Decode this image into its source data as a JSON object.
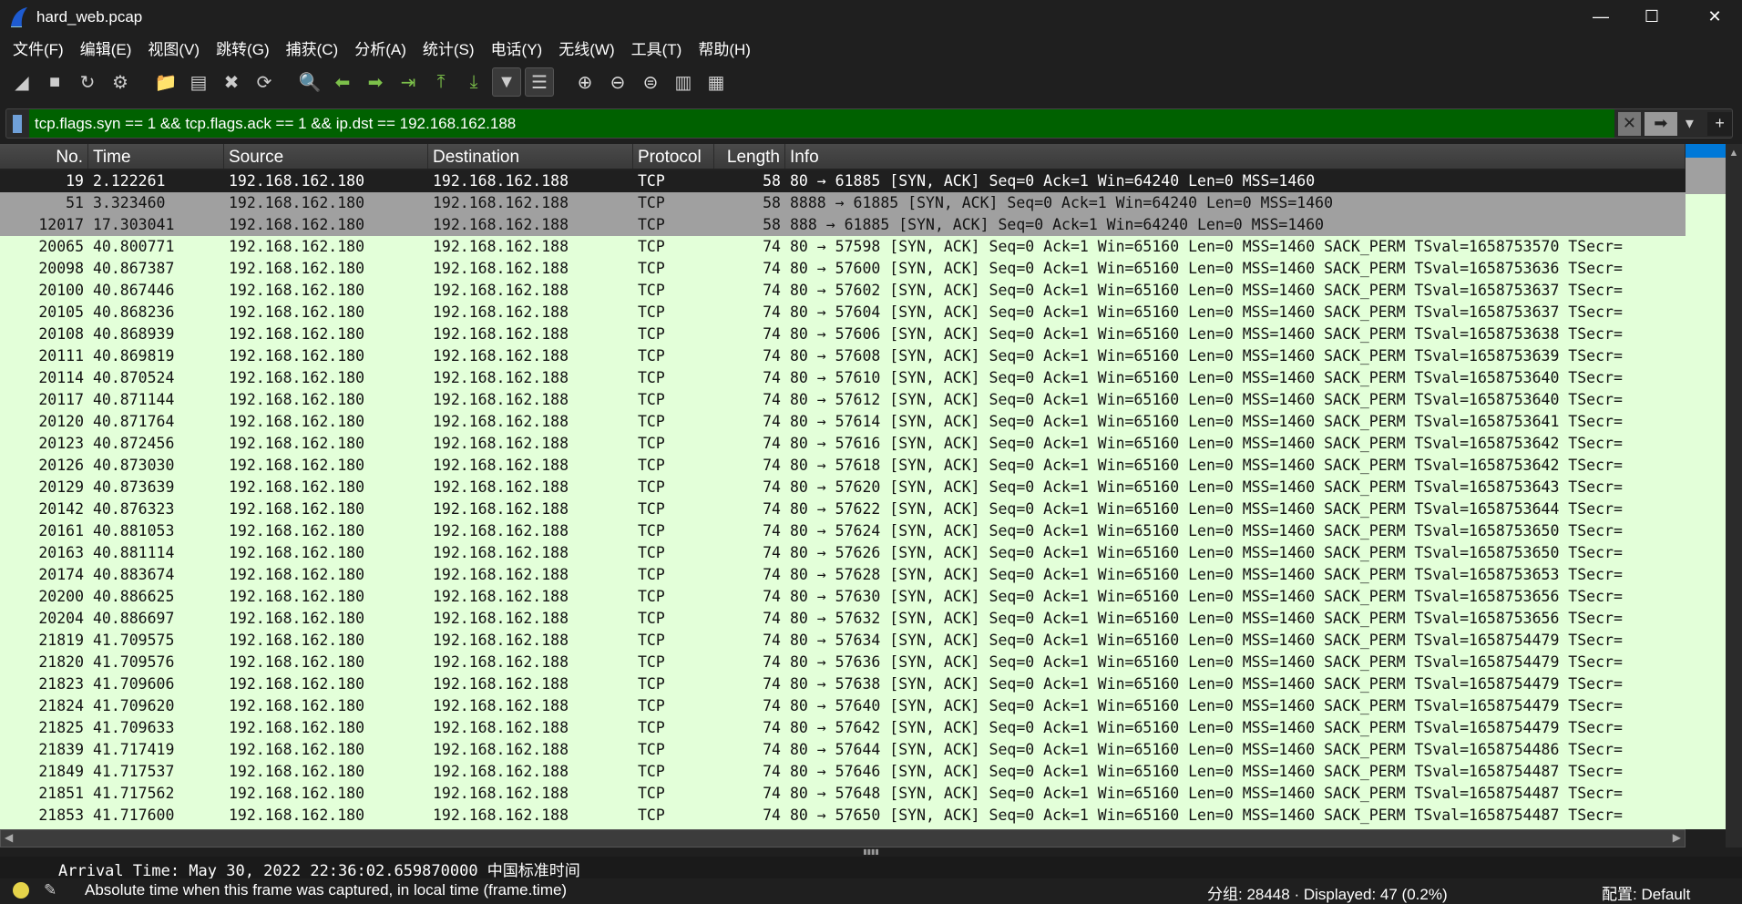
{
  "window": {
    "title": "hard_web.pcap",
    "minimize": "—",
    "maximize": "☐",
    "close": "✕"
  },
  "menu": [
    "文件(F)",
    "编辑(E)",
    "视图(V)",
    "跳转(G)",
    "捕获(C)",
    "分析(A)",
    "统计(S)",
    "电话(Y)",
    "无线(W)",
    "工具(T)",
    "帮助(H)"
  ],
  "toolbar": [
    {
      "icon": "start-capture-icon",
      "glyph": "◢"
    },
    {
      "icon": "stop-capture-icon",
      "glyph": "■"
    },
    {
      "icon": "restart-capture-icon",
      "glyph": "↻"
    },
    {
      "icon": "capture-options-icon",
      "glyph": "⚙"
    },
    "sep",
    {
      "icon": "open-file-icon",
      "glyph": "📁"
    },
    {
      "icon": "save-file-icon",
      "glyph": "▤"
    },
    {
      "icon": "close-file-icon",
      "glyph": "✖"
    },
    {
      "icon": "reload-file-icon",
      "glyph": "⟳"
    },
    "sep",
    {
      "icon": "find-packet-icon",
      "glyph": "🔍"
    },
    {
      "icon": "go-back-icon",
      "glyph": "⬅"
    },
    {
      "icon": "go-forward-icon",
      "glyph": "➡"
    },
    {
      "icon": "go-to-packet-icon",
      "glyph": "⇥"
    },
    {
      "icon": "go-first-icon",
      "glyph": "⤒"
    },
    {
      "icon": "go-last-icon",
      "glyph": "⤓"
    },
    {
      "icon": "auto-scroll-icon",
      "glyph": "▼",
      "active": true
    },
    {
      "icon": "colorize-icon",
      "glyph": "☰",
      "active": true
    },
    "sep",
    {
      "icon": "zoom-in-icon",
      "glyph": "⊕"
    },
    {
      "icon": "zoom-out-icon",
      "glyph": "⊖"
    },
    {
      "icon": "zoom-reset-icon",
      "glyph": "⊜"
    },
    {
      "icon": "resize-columns-icon",
      "glyph": "▥"
    },
    {
      "icon": "layout-icon",
      "glyph": "▦"
    }
  ],
  "filter": {
    "value": "tcp.flags.syn == 1 && tcp.flags.ack == 1 && ip.dst == 192.168.162.188",
    "clear": "✕",
    "apply": "➡",
    "dropdown": "▾",
    "add": "+"
  },
  "columns": [
    "No.",
    "Time",
    "Source",
    "Destination",
    "Protocol",
    "Length",
    "Info"
  ],
  "colors": {
    "selected": "#1f1f1f",
    "gray": "#a0a0a0",
    "normal": "#e3ffd9",
    "filter_ok": "#006100"
  },
  "packets": [
    {
      "no": "19",
      "time": "2.122261",
      "src": "192.168.162.180",
      "dst": "192.168.162.188",
      "proto": "TCP",
      "len": "58",
      "info": "80 → 61885 [SYN, ACK] Seq=0 Ack=1 Win=64240 Len=0 MSS=1460",
      "style": "sel"
    },
    {
      "no": "51",
      "time": "3.323460",
      "src": "192.168.162.180",
      "dst": "192.168.162.188",
      "proto": "TCP",
      "len": "58",
      "info": "8888 → 61885 [SYN, ACK] Seq=0 Ack=1 Win=64240 Len=0 MSS=1460",
      "style": "gray"
    },
    {
      "no": "12017",
      "time": "17.303041",
      "src": "192.168.162.180",
      "dst": "192.168.162.188",
      "proto": "TCP",
      "len": "58",
      "info": "888 → 61885 [SYN, ACK] Seq=0 Ack=1 Win=64240 Len=0 MSS=1460",
      "style": "gray"
    },
    {
      "no": "20065",
      "time": "40.800771",
      "src": "192.168.162.180",
      "dst": "192.168.162.188",
      "proto": "TCP",
      "len": "74",
      "info": "80 → 57598 [SYN, ACK] Seq=0 Ack=1 Win=65160 Len=0 MSS=1460 SACK_PERM TSval=1658753570 TSecr="
    },
    {
      "no": "20098",
      "time": "40.867387",
      "src": "192.168.162.180",
      "dst": "192.168.162.188",
      "proto": "TCP",
      "len": "74",
      "info": "80 → 57600 [SYN, ACK] Seq=0 Ack=1 Win=65160 Len=0 MSS=1460 SACK_PERM TSval=1658753636 TSecr="
    },
    {
      "no": "20100",
      "time": "40.867446",
      "src": "192.168.162.180",
      "dst": "192.168.162.188",
      "proto": "TCP",
      "len": "74",
      "info": "80 → 57602 [SYN, ACK] Seq=0 Ack=1 Win=65160 Len=0 MSS=1460 SACK_PERM TSval=1658753637 TSecr="
    },
    {
      "no": "20105",
      "time": "40.868236",
      "src": "192.168.162.180",
      "dst": "192.168.162.188",
      "proto": "TCP",
      "len": "74",
      "info": "80 → 57604 [SYN, ACK] Seq=0 Ack=1 Win=65160 Len=0 MSS=1460 SACK_PERM TSval=1658753637 TSecr="
    },
    {
      "no": "20108",
      "time": "40.868939",
      "src": "192.168.162.180",
      "dst": "192.168.162.188",
      "proto": "TCP",
      "len": "74",
      "info": "80 → 57606 [SYN, ACK] Seq=0 Ack=1 Win=65160 Len=0 MSS=1460 SACK_PERM TSval=1658753638 TSecr="
    },
    {
      "no": "20111",
      "time": "40.869819",
      "src": "192.168.162.180",
      "dst": "192.168.162.188",
      "proto": "TCP",
      "len": "74",
      "info": "80 → 57608 [SYN, ACK] Seq=0 Ack=1 Win=65160 Len=0 MSS=1460 SACK_PERM TSval=1658753639 TSecr="
    },
    {
      "no": "20114",
      "time": "40.870524",
      "src": "192.168.162.180",
      "dst": "192.168.162.188",
      "proto": "TCP",
      "len": "74",
      "info": "80 → 57610 [SYN, ACK] Seq=0 Ack=1 Win=65160 Len=0 MSS=1460 SACK_PERM TSval=1658753640 TSecr="
    },
    {
      "no": "20117",
      "time": "40.871144",
      "src": "192.168.162.180",
      "dst": "192.168.162.188",
      "proto": "TCP",
      "len": "74",
      "info": "80 → 57612 [SYN, ACK] Seq=0 Ack=1 Win=65160 Len=0 MSS=1460 SACK_PERM TSval=1658753640 TSecr="
    },
    {
      "no": "20120",
      "time": "40.871764",
      "src": "192.168.162.180",
      "dst": "192.168.162.188",
      "proto": "TCP",
      "len": "74",
      "info": "80 → 57614 [SYN, ACK] Seq=0 Ack=1 Win=65160 Len=0 MSS=1460 SACK_PERM TSval=1658753641 TSecr="
    },
    {
      "no": "20123",
      "time": "40.872456",
      "src": "192.168.162.180",
      "dst": "192.168.162.188",
      "proto": "TCP",
      "len": "74",
      "info": "80 → 57616 [SYN, ACK] Seq=0 Ack=1 Win=65160 Len=0 MSS=1460 SACK_PERM TSval=1658753642 TSecr="
    },
    {
      "no": "20126",
      "time": "40.873030",
      "src": "192.168.162.180",
      "dst": "192.168.162.188",
      "proto": "TCP",
      "len": "74",
      "info": "80 → 57618 [SYN, ACK] Seq=0 Ack=1 Win=65160 Len=0 MSS=1460 SACK_PERM TSval=1658753642 TSecr="
    },
    {
      "no": "20129",
      "time": "40.873639",
      "src": "192.168.162.180",
      "dst": "192.168.162.188",
      "proto": "TCP",
      "len": "74",
      "info": "80 → 57620 [SYN, ACK] Seq=0 Ack=1 Win=65160 Len=0 MSS=1460 SACK_PERM TSval=1658753643 TSecr="
    },
    {
      "no": "20142",
      "time": "40.876323",
      "src": "192.168.162.180",
      "dst": "192.168.162.188",
      "proto": "TCP",
      "len": "74",
      "info": "80 → 57622 [SYN, ACK] Seq=0 Ack=1 Win=65160 Len=0 MSS=1460 SACK_PERM TSval=1658753644 TSecr="
    },
    {
      "no": "20161",
      "time": "40.881053",
      "src": "192.168.162.180",
      "dst": "192.168.162.188",
      "proto": "TCP",
      "len": "74",
      "info": "80 → 57624 [SYN, ACK] Seq=0 Ack=1 Win=65160 Len=0 MSS=1460 SACK_PERM TSval=1658753650 TSecr="
    },
    {
      "no": "20163",
      "time": "40.881114",
      "src": "192.168.162.180",
      "dst": "192.168.162.188",
      "proto": "TCP",
      "len": "74",
      "info": "80 → 57626 [SYN, ACK] Seq=0 Ack=1 Win=65160 Len=0 MSS=1460 SACK_PERM TSval=1658753650 TSecr="
    },
    {
      "no": "20174",
      "time": "40.883674",
      "src": "192.168.162.180",
      "dst": "192.168.162.188",
      "proto": "TCP",
      "len": "74",
      "info": "80 → 57628 [SYN, ACK] Seq=0 Ack=1 Win=65160 Len=0 MSS=1460 SACK_PERM TSval=1658753653 TSecr="
    },
    {
      "no": "20200",
      "time": "40.886625",
      "src": "192.168.162.180",
      "dst": "192.168.162.188",
      "proto": "TCP",
      "len": "74",
      "info": "80 → 57630 [SYN, ACK] Seq=0 Ack=1 Win=65160 Len=0 MSS=1460 SACK_PERM TSval=1658753656 TSecr="
    },
    {
      "no": "20204",
      "time": "40.886697",
      "src": "192.168.162.180",
      "dst": "192.168.162.188",
      "proto": "TCP",
      "len": "74",
      "info": "80 → 57632 [SYN, ACK] Seq=0 Ack=1 Win=65160 Len=0 MSS=1460 SACK_PERM TSval=1658753656 TSecr="
    },
    {
      "no": "21819",
      "time": "41.709575",
      "src": "192.168.162.180",
      "dst": "192.168.162.188",
      "proto": "TCP",
      "len": "74",
      "info": "80 → 57634 [SYN, ACK] Seq=0 Ack=1 Win=65160 Len=0 MSS=1460 SACK_PERM TSval=1658754479 TSecr="
    },
    {
      "no": "21820",
      "time": "41.709576",
      "src": "192.168.162.180",
      "dst": "192.168.162.188",
      "proto": "TCP",
      "len": "74",
      "info": "80 → 57636 [SYN, ACK] Seq=0 Ack=1 Win=65160 Len=0 MSS=1460 SACK_PERM TSval=1658754479 TSecr="
    },
    {
      "no": "21823",
      "time": "41.709606",
      "src": "192.168.162.180",
      "dst": "192.168.162.188",
      "proto": "TCP",
      "len": "74",
      "info": "80 → 57638 [SYN, ACK] Seq=0 Ack=1 Win=65160 Len=0 MSS=1460 SACK_PERM TSval=1658754479 TSecr="
    },
    {
      "no": "21824",
      "time": "41.709620",
      "src": "192.168.162.180",
      "dst": "192.168.162.188",
      "proto": "TCP",
      "len": "74",
      "info": "80 → 57640 [SYN, ACK] Seq=0 Ack=1 Win=65160 Len=0 MSS=1460 SACK_PERM TSval=1658754479 TSecr="
    },
    {
      "no": "21825",
      "time": "41.709633",
      "src": "192.168.162.180",
      "dst": "192.168.162.188",
      "proto": "TCP",
      "len": "74",
      "info": "80 → 57642 [SYN, ACK] Seq=0 Ack=1 Win=65160 Len=0 MSS=1460 SACK_PERM TSval=1658754479 TSecr="
    },
    {
      "no": "21839",
      "time": "41.717419",
      "src": "192.168.162.180",
      "dst": "192.168.162.188",
      "proto": "TCP",
      "len": "74",
      "info": "80 → 57644 [SYN, ACK] Seq=0 Ack=1 Win=65160 Len=0 MSS=1460 SACK_PERM TSval=1658754486 TSecr="
    },
    {
      "no": "21849",
      "time": "41.717537",
      "src": "192.168.162.180",
      "dst": "192.168.162.188",
      "proto": "TCP",
      "len": "74",
      "info": "80 → 57646 [SYN, ACK] Seq=0 Ack=1 Win=65160 Len=0 MSS=1460 SACK_PERM TSval=1658754487 TSecr="
    },
    {
      "no": "21851",
      "time": "41.717562",
      "src": "192.168.162.180",
      "dst": "192.168.162.188",
      "proto": "TCP",
      "len": "74",
      "info": "80 → 57648 [SYN, ACK] Seq=0 Ack=1 Win=65160 Len=0 MSS=1460 SACK_PERM TSval=1658754487 TSecr="
    },
    {
      "no": "21853",
      "time": "41.717600",
      "src": "192.168.162.180",
      "dst": "192.168.162.188",
      "proto": "TCP",
      "len": "74",
      "info": "80 → 57650 [SYN, ACK] Seq=0 Ack=1 Win=65160 Len=0 MSS=1460 SACK_PERM TSval=1658754487 TSecr="
    }
  ],
  "detail": {
    "text": "Arrival Time: May 30, 2022 22:36:02.659870000 中国标准时间"
  },
  "status": {
    "field_desc": "Absolute time when this frame was captured, in local time (frame.time)",
    "packets": "分组: 28448 · Displayed: 47 (0.2%)",
    "profile": "配置: Default"
  }
}
